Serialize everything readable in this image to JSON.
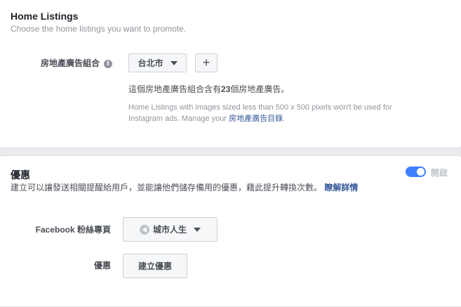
{
  "listings": {
    "title": "Home Listings",
    "subtitle": "Choose the home listings you want to promote.",
    "set_label": "房地產廣告組合",
    "info_icon": "i",
    "city_dropdown": "台北市",
    "add_button": "+",
    "count_prefix": "這個房地產廣告組合含有",
    "count": "23",
    "count_suffix": "個房地產廣告。",
    "note_text": "Home Listings with images sized less than 500 x 500 pixels won't be used for Instagram ads. Manage your ",
    "note_link": "房地產廣告目錄",
    "note_end": "."
  },
  "offers": {
    "title": "優惠",
    "description": "建立可以讓發送相關提醒給用戶，並能讓他們儲存備用的優惠，藉此提升轉換次數。",
    "learn_more": "瞭解詳情",
    "toggle_label": "開啟",
    "toggle_on": true,
    "page_label": "Facebook 粉絲專頁",
    "page_dropdown": "城市人生",
    "offer_label": "優惠",
    "create_button": "建立優惠"
  }
}
